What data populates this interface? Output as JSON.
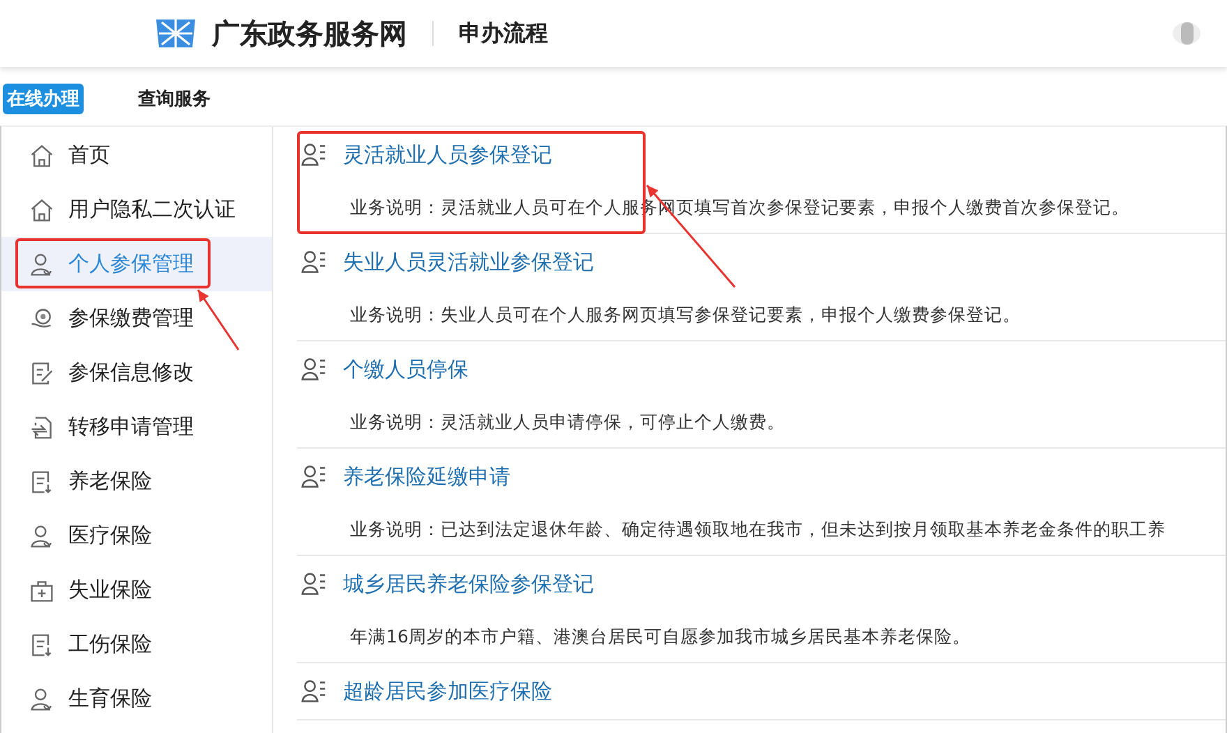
{
  "header": {
    "site_title": "广东政务服务网",
    "page_title": "申办流程"
  },
  "tabs": [
    {
      "label": "在线办理",
      "selected": true
    },
    {
      "label": "查询服务",
      "selected": false
    }
  ],
  "sidebar": {
    "items": [
      {
        "label": "首页",
        "kind": "home",
        "selected": false,
        "annotated": false
      },
      {
        "label": "用户隐私二次认证",
        "kind": "home",
        "selected": false,
        "annotated": false
      },
      {
        "label": "个人参保管理",
        "kind": "person",
        "selected": true,
        "annotated": true
      },
      {
        "label": "参保缴费管理",
        "kind": "coin",
        "selected": false,
        "annotated": false
      },
      {
        "label": "参保信息修改",
        "kind": "edit",
        "selected": false,
        "annotated": false
      },
      {
        "label": "转移申请管理",
        "kind": "transfer",
        "selected": false,
        "annotated": false
      },
      {
        "label": "养老保险",
        "kind": "document",
        "selected": false,
        "annotated": false
      },
      {
        "label": "医疗保险",
        "kind": "person",
        "selected": false,
        "annotated": false
      },
      {
        "label": "失业保险",
        "kind": "case",
        "selected": false,
        "annotated": false
      },
      {
        "label": "工伤保险",
        "kind": "document",
        "selected": false,
        "annotated": false
      },
      {
        "label": "生育保险",
        "kind": "person",
        "selected": false,
        "annotated": false
      }
    ]
  },
  "services": [
    {
      "title": "灵活就业人员参保登记",
      "description": "业务说明：灵活就业人员可在个人服务网页填写首次参保登记要素，申报个人缴费首次参保登记。",
      "annotated": true
    },
    {
      "title": "失业人员灵活就业参保登记",
      "description": "业务说明：失业人员可在个人服务网页填写参保登记要素，申报个人缴费参保登记。",
      "annotated": false
    },
    {
      "title": "个缴人员停保",
      "description": "业务说明：灵活就业人员申请停保，可停止个人缴费。",
      "annotated": false
    },
    {
      "title": "养老保险延缴申请",
      "description": "业务说明：已达到法定退休年龄、确定待遇领取地在我市，但未达到按月领取基本养老金条件的职工养",
      "annotated": false
    },
    {
      "title": "城乡居民养老保险参保登记",
      "description": "年满16周岁的本市户籍、港澳台居民可自愿参加我市城乡居民基本养老保险。",
      "annotated": false
    },
    {
      "title": "超龄居民参加医疗保险",
      "annotated": false
    }
  ]
}
